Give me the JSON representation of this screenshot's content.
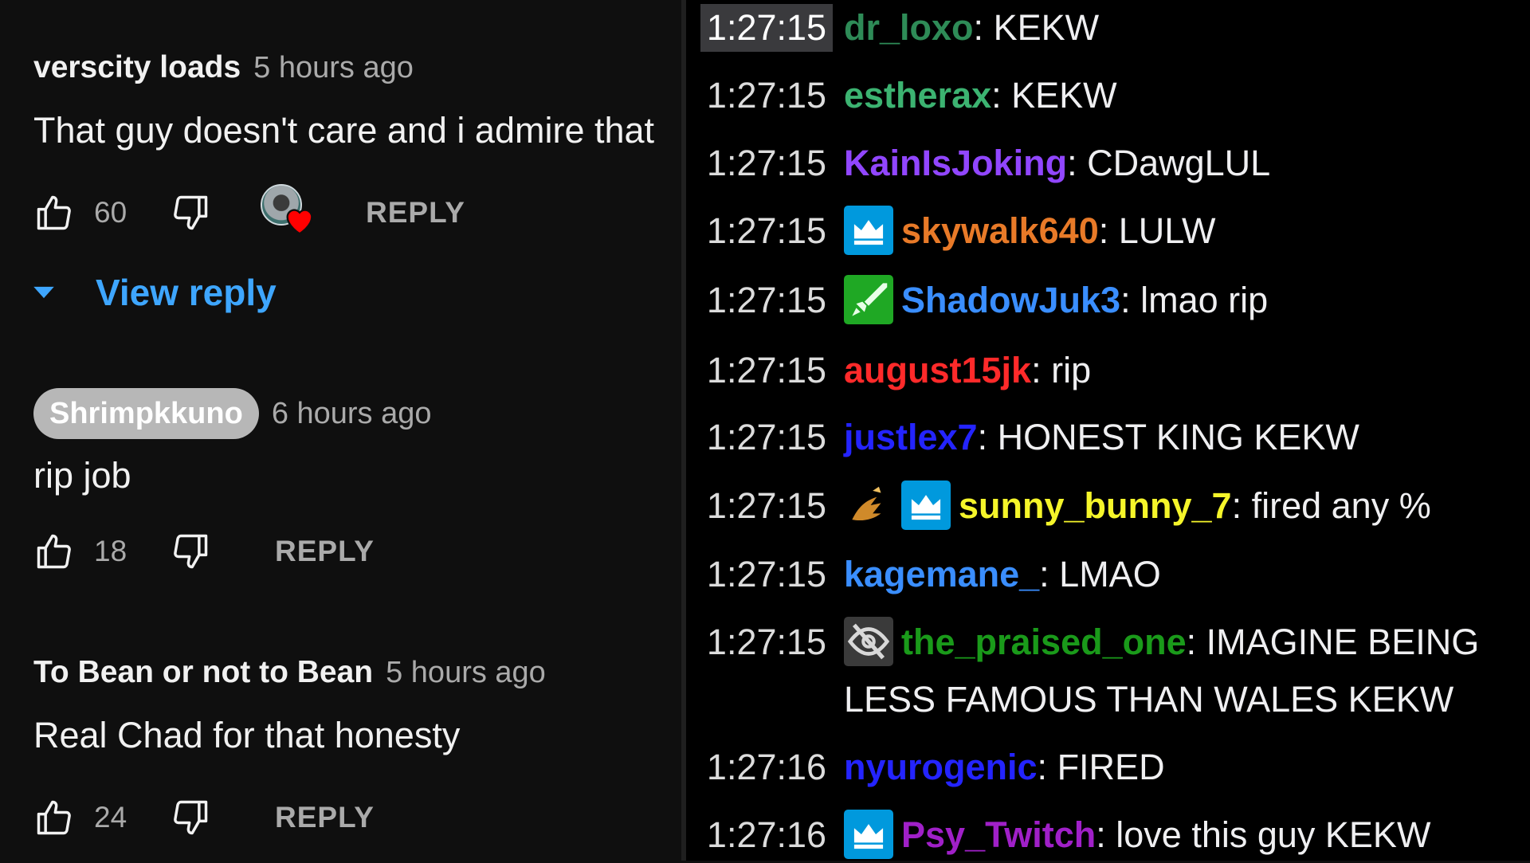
{
  "comments": [
    {
      "author": "verscity loads",
      "author_pill": false,
      "time": "5 hours ago",
      "text": "That guy doesn't care and i admire that",
      "likes": "60",
      "creator_heart": true,
      "reply_label": "REPLY",
      "view_reply_label": "View reply"
    },
    {
      "author": "Shrimpkkuno",
      "author_pill": true,
      "time": "6 hours ago",
      "text": "rip job",
      "likes": "18",
      "creator_heart": false,
      "reply_label": "REPLY"
    },
    {
      "author": "To Bean or not to Bean",
      "author_pill": false,
      "time": "5 hours ago",
      "text": "Real Chad for that honesty",
      "likes": "24",
      "creator_heart": false,
      "reply_label": "REPLY"
    }
  ],
  "chat": {
    "messages": [
      {
        "time": "1:27:15",
        "user": "dr_loxo",
        "color": "#2e8b57",
        "text": "KEKW",
        "badges": [],
        "highlight": true
      },
      {
        "time": "1:27:15",
        "user": "estherax",
        "color": "#3cb371",
        "text": "KEKW",
        "badges": []
      },
      {
        "time": "1:27:15",
        "user": "KainIsJoking",
        "color": "#9146ff",
        "text": "CDawgLUL",
        "badges": []
      },
      {
        "time": "1:27:15",
        "user": "skywalk640",
        "color": "#e87a28",
        "text": "LULW",
        "badges": [
          "prime-crown-icon"
        ]
      },
      {
        "time": "1:27:15",
        "user": "ShadowJuk3",
        "color": "#3a8eff",
        "text": "lmao rip",
        "badges": [
          "sword-icon"
        ]
      },
      {
        "time": "1:27:15",
        "user": "august15jk",
        "color": "#ff2a2a",
        "text": "rip",
        "badges": []
      },
      {
        "time": "1:27:15",
        "user": "justlex7",
        "color": "#2424ff",
        "text": "HONEST KING KEKW",
        "badges": []
      },
      {
        "time": "1:27:15",
        "user": "sunny_bunny_7",
        "color": "#f5f52a",
        "text": "fired any %",
        "badges": [
          "dragon-icon",
          "prime-crown-icon"
        ]
      },
      {
        "time": "1:27:15",
        "user": "kagemane_",
        "color": "#3a8eff",
        "text": "LMAO",
        "badges": []
      },
      {
        "time": "1:27:15",
        "user": "the_praised_one",
        "color": "#1a9a1a",
        "text": "IMAGINE BEING",
        "text_line2": "LESS FAMOUS THAN WALES KEKW",
        "badges": [
          "no-eye-icon"
        ]
      },
      {
        "time": "1:27:16",
        "user": "nyurogenic",
        "color": "#2424ff",
        "text": "FIRED",
        "badges": []
      },
      {
        "time": "1:27:16",
        "user": "Psy_Twitch",
        "color": "#a020c8",
        "text": "love this guy KEKW",
        "badges": [
          "prime-crown-icon"
        ]
      }
    ]
  }
}
